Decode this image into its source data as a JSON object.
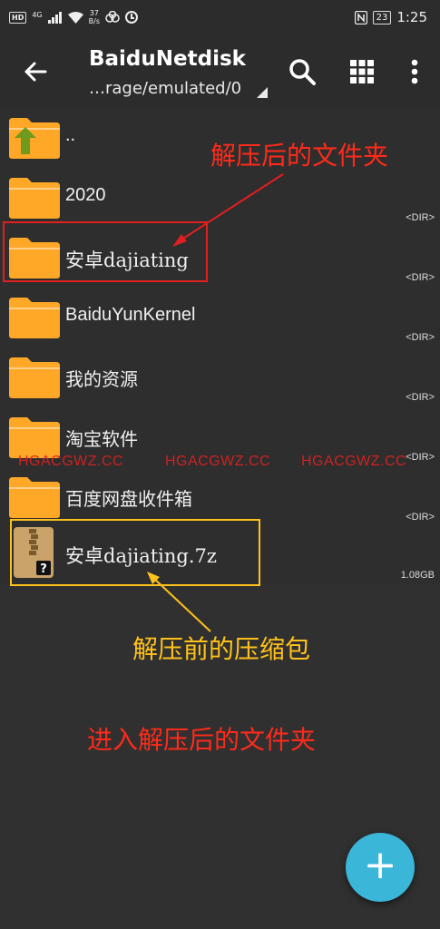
{
  "status_bar": {
    "hd": "HD",
    "network": "4G",
    "speed_value": "37",
    "speed_unit": "B/s",
    "battery": "23",
    "time": "1:25"
  },
  "toolbar": {
    "title": "BaiduNetdisk",
    "path": "…rage/emulated/0"
  },
  "files": [
    {
      "name": "..",
      "meta": "",
      "type": "parent"
    },
    {
      "name": "2020",
      "meta": "<DIR>",
      "type": "folder"
    },
    {
      "name": "安卓dajiating",
      "meta": "<DIR>",
      "type": "folder"
    },
    {
      "name": "BaiduYunKernel",
      "meta": "<DIR>",
      "type": "folder"
    },
    {
      "name": "我的资源",
      "meta": "<DIR>",
      "type": "folder"
    },
    {
      "name": "淘宝软件",
      "meta": "<DIR>",
      "type": "folder"
    },
    {
      "name": "百度网盘收件箱",
      "meta": "<DIR>",
      "type": "folder"
    },
    {
      "name": "安卓dajiating.7z",
      "meta": "1.08GB",
      "type": "archive"
    }
  ],
  "annotations": {
    "after_extract_folder": "解压后的文件夹",
    "before_extract_archive": "解压前的压缩包",
    "enter_folder": "进入解压后的文件夹"
  },
  "watermark": "HGACGWZ.CC",
  "colors": {
    "folder": "#ffa726",
    "accent_fab": "#39b6d8",
    "annotation_red": "#ff2a1a",
    "annotation_yellow": "#ffc21a"
  }
}
